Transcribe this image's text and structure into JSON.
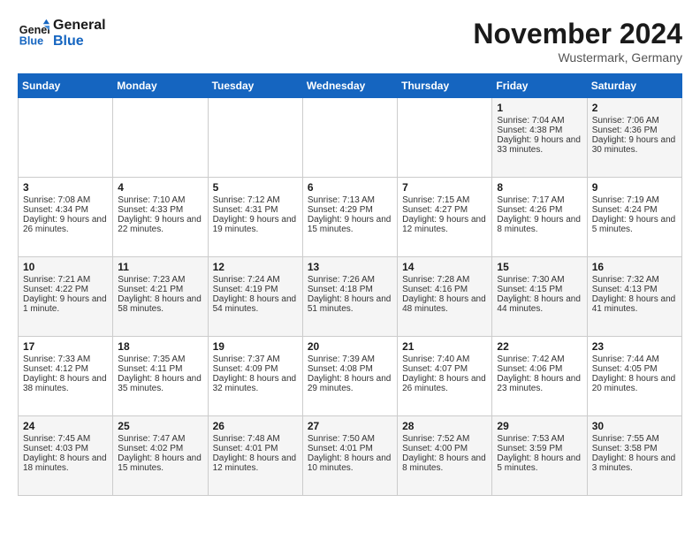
{
  "header": {
    "logo_line1": "General",
    "logo_line2": "Blue",
    "month_title": "November 2024",
    "location": "Wustermark, Germany"
  },
  "days_of_week": [
    "Sunday",
    "Monday",
    "Tuesday",
    "Wednesday",
    "Thursday",
    "Friday",
    "Saturday"
  ],
  "weeks": [
    [
      {
        "day": "",
        "info": ""
      },
      {
        "day": "",
        "info": ""
      },
      {
        "day": "",
        "info": ""
      },
      {
        "day": "",
        "info": ""
      },
      {
        "day": "",
        "info": ""
      },
      {
        "day": "1",
        "info": "Sunrise: 7:04 AM\nSunset: 4:38 PM\nDaylight: 9 hours and 33 minutes."
      },
      {
        "day": "2",
        "info": "Sunrise: 7:06 AM\nSunset: 4:36 PM\nDaylight: 9 hours and 30 minutes."
      }
    ],
    [
      {
        "day": "3",
        "info": "Sunrise: 7:08 AM\nSunset: 4:34 PM\nDaylight: 9 hours and 26 minutes."
      },
      {
        "day": "4",
        "info": "Sunrise: 7:10 AM\nSunset: 4:33 PM\nDaylight: 9 hours and 22 minutes."
      },
      {
        "day": "5",
        "info": "Sunrise: 7:12 AM\nSunset: 4:31 PM\nDaylight: 9 hours and 19 minutes."
      },
      {
        "day": "6",
        "info": "Sunrise: 7:13 AM\nSunset: 4:29 PM\nDaylight: 9 hours and 15 minutes."
      },
      {
        "day": "7",
        "info": "Sunrise: 7:15 AM\nSunset: 4:27 PM\nDaylight: 9 hours and 12 minutes."
      },
      {
        "day": "8",
        "info": "Sunrise: 7:17 AM\nSunset: 4:26 PM\nDaylight: 9 hours and 8 minutes."
      },
      {
        "day": "9",
        "info": "Sunrise: 7:19 AM\nSunset: 4:24 PM\nDaylight: 9 hours and 5 minutes."
      }
    ],
    [
      {
        "day": "10",
        "info": "Sunrise: 7:21 AM\nSunset: 4:22 PM\nDaylight: 9 hours and 1 minute."
      },
      {
        "day": "11",
        "info": "Sunrise: 7:23 AM\nSunset: 4:21 PM\nDaylight: 8 hours and 58 minutes."
      },
      {
        "day": "12",
        "info": "Sunrise: 7:24 AM\nSunset: 4:19 PM\nDaylight: 8 hours and 54 minutes."
      },
      {
        "day": "13",
        "info": "Sunrise: 7:26 AM\nSunset: 4:18 PM\nDaylight: 8 hours and 51 minutes."
      },
      {
        "day": "14",
        "info": "Sunrise: 7:28 AM\nSunset: 4:16 PM\nDaylight: 8 hours and 48 minutes."
      },
      {
        "day": "15",
        "info": "Sunrise: 7:30 AM\nSunset: 4:15 PM\nDaylight: 8 hours and 44 minutes."
      },
      {
        "day": "16",
        "info": "Sunrise: 7:32 AM\nSunset: 4:13 PM\nDaylight: 8 hours and 41 minutes."
      }
    ],
    [
      {
        "day": "17",
        "info": "Sunrise: 7:33 AM\nSunset: 4:12 PM\nDaylight: 8 hours and 38 minutes."
      },
      {
        "day": "18",
        "info": "Sunrise: 7:35 AM\nSunset: 4:11 PM\nDaylight: 8 hours and 35 minutes."
      },
      {
        "day": "19",
        "info": "Sunrise: 7:37 AM\nSunset: 4:09 PM\nDaylight: 8 hours and 32 minutes."
      },
      {
        "day": "20",
        "info": "Sunrise: 7:39 AM\nSunset: 4:08 PM\nDaylight: 8 hours and 29 minutes."
      },
      {
        "day": "21",
        "info": "Sunrise: 7:40 AM\nSunset: 4:07 PM\nDaylight: 8 hours and 26 minutes."
      },
      {
        "day": "22",
        "info": "Sunrise: 7:42 AM\nSunset: 4:06 PM\nDaylight: 8 hours and 23 minutes."
      },
      {
        "day": "23",
        "info": "Sunrise: 7:44 AM\nSunset: 4:05 PM\nDaylight: 8 hours and 20 minutes."
      }
    ],
    [
      {
        "day": "24",
        "info": "Sunrise: 7:45 AM\nSunset: 4:03 PM\nDaylight: 8 hours and 18 minutes."
      },
      {
        "day": "25",
        "info": "Sunrise: 7:47 AM\nSunset: 4:02 PM\nDaylight: 8 hours and 15 minutes."
      },
      {
        "day": "26",
        "info": "Sunrise: 7:48 AM\nSunset: 4:01 PM\nDaylight: 8 hours and 12 minutes."
      },
      {
        "day": "27",
        "info": "Sunrise: 7:50 AM\nSunset: 4:01 PM\nDaylight: 8 hours and 10 minutes."
      },
      {
        "day": "28",
        "info": "Sunrise: 7:52 AM\nSunset: 4:00 PM\nDaylight: 8 hours and 8 minutes."
      },
      {
        "day": "29",
        "info": "Sunrise: 7:53 AM\nSunset: 3:59 PM\nDaylight: 8 hours and 5 minutes."
      },
      {
        "day": "30",
        "info": "Sunrise: 7:55 AM\nSunset: 3:58 PM\nDaylight: 8 hours and 3 minutes."
      }
    ]
  ]
}
